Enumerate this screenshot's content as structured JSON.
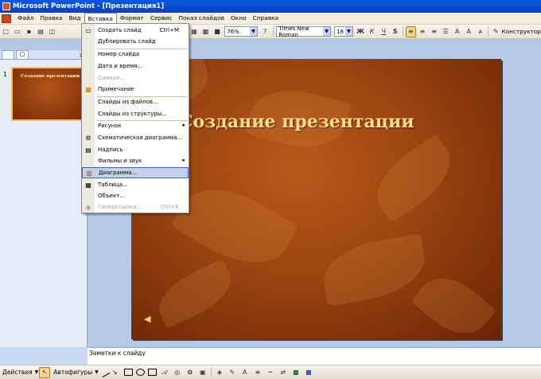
{
  "window": {
    "title": "Microsoft PowerPoint - [Презентация1]"
  },
  "menubar": {
    "items": [
      "Файл",
      "Правка",
      "Вид",
      "Вставка",
      "Формат",
      "Сервис",
      "Показ слайдов",
      "Окно",
      "Справка"
    ],
    "active": "Вставка"
  },
  "toolbar": {
    "zoom": "76%",
    "font": "Times New Roman",
    "size": "18",
    "bold": "Ж",
    "italic": "К",
    "underline": "Ч",
    "shadow": "S",
    "designer": "Конструктор"
  },
  "insert_menu": {
    "items": [
      {
        "label": "Создать слайд",
        "shortcut": "Ctrl+M",
        "icon": "new-slide-icon",
        "disabled": false
      },
      {
        "label": "Дублировать слайд",
        "shortcut": "",
        "icon": "",
        "disabled": false
      },
      {
        "label": "Номер слайда",
        "shortcut": "",
        "icon": "",
        "disabled": false
      },
      {
        "label": "Дата и время...",
        "shortcut": "",
        "icon": "",
        "disabled": false
      },
      {
        "label": "Символ...",
        "shortcut": "",
        "icon": "",
        "disabled": true
      },
      {
        "label": "Примечание",
        "shortcut": "",
        "icon": "comment-icon",
        "disabled": false
      },
      {
        "label": "Слайды из файлов...",
        "shortcut": "",
        "icon": "",
        "disabled": false
      },
      {
        "label": "Слайды из структуры...",
        "shortcut": "",
        "icon": "",
        "disabled": false
      },
      {
        "label": "Рисунок",
        "shortcut": "",
        "icon": "",
        "disabled": false,
        "submenu": true
      },
      {
        "label": "Схематическая диаграмма...",
        "shortcut": "",
        "icon": "diagram-icon",
        "disabled": false
      },
      {
        "label": "Надпись",
        "shortcut": "",
        "icon": "textbox-icon",
        "disabled": false
      },
      {
        "label": "Фильмы и звук",
        "shortcut": "",
        "icon": "",
        "disabled": false,
        "submenu": true
      },
      {
        "label": "Диаграмма...",
        "shortcut": "",
        "icon": "chart-icon",
        "disabled": false,
        "selected": true
      },
      {
        "label": "Таблица...",
        "shortcut": "",
        "icon": "table-icon",
        "disabled": false
      },
      {
        "label": "Объект...",
        "shortcut": "",
        "icon": "",
        "disabled": false
      },
      {
        "label": "Гиперссылка...",
        "shortcut": "Ctrl+K",
        "icon": "hyperlink-icon",
        "disabled": true
      }
    ]
  },
  "slides_panel": {
    "slide_number": "1",
    "thumb_title": "Создание презентации"
  },
  "slide": {
    "title": "Создание презентации"
  },
  "notes": {
    "placeholder": "Заметки к слайду"
  },
  "drawbar": {
    "actions": "Действия",
    "autoshapes": "Автофигуры"
  },
  "colors": {
    "accent": "#0a58e0",
    "slide_bg": "#9a4410",
    "title_text": "#ffe08a"
  }
}
